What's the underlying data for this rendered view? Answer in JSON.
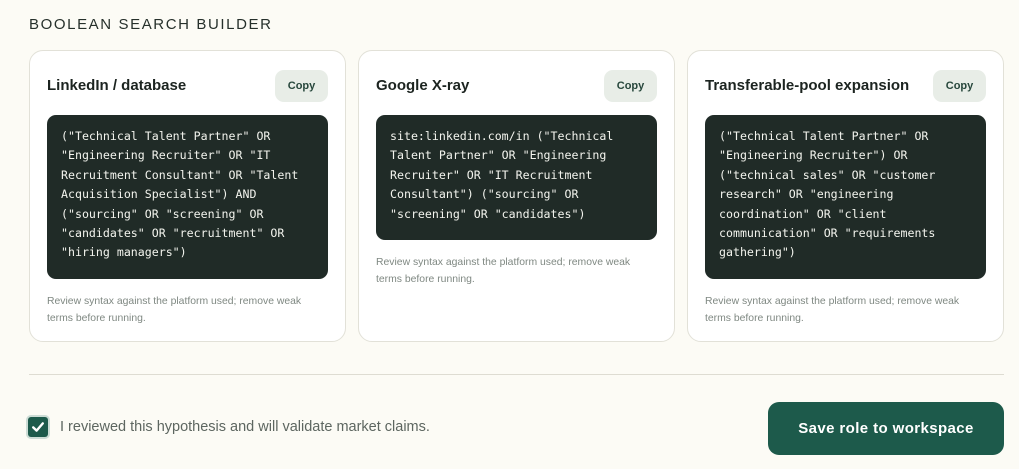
{
  "header": {
    "title": "BOOLEAN SEARCH BUILDER"
  },
  "cards": [
    {
      "title": "LinkedIn / database",
      "copy_label": "Copy",
      "query": "(\"Technical Talent Partner\" OR \"Engineering Recruiter\" OR \"IT Recruitment Consultant\" OR \"Talent Acquisition Specialist\") AND (\"sourcing\" OR \"screening\" OR \"candidates\" OR \"recruitment\" OR \"hiring managers\")",
      "note": "Review syntax against the platform used; remove weak terms before running."
    },
    {
      "title": "Google X-ray",
      "copy_label": "Copy",
      "query": "site:linkedin.com/in (\"Technical Talent Partner\" OR \"Engineering Recruiter\" OR \"IT Recruitment Consultant\") (\"sourcing\" OR \"screening\" OR \"candidates\")",
      "note": "Review syntax against the platform used; remove weak terms before running."
    },
    {
      "title": "Transferable-pool expansion",
      "copy_label": "Copy",
      "query": "(\"Technical Talent Partner\" OR \"Engineering Recruiter\") OR (\"technical sales\" OR \"customer research\" OR \"engineering coordination\" OR \"client communication\" OR \"requirements gathering\")",
      "note": "Review syntax against the platform used; remove weak terms before running."
    }
  ],
  "footer": {
    "checkbox_checked": true,
    "checkbox_label": "I reviewed this hypothesis and will validate market claims.",
    "save_label": "Save role to workspace"
  },
  "colors": {
    "accent": "#1d5a4b",
    "code_background": "#202b27",
    "page_background": "#fcfbf5"
  },
  "icons": {
    "checkbox": "checkmark-icon"
  }
}
